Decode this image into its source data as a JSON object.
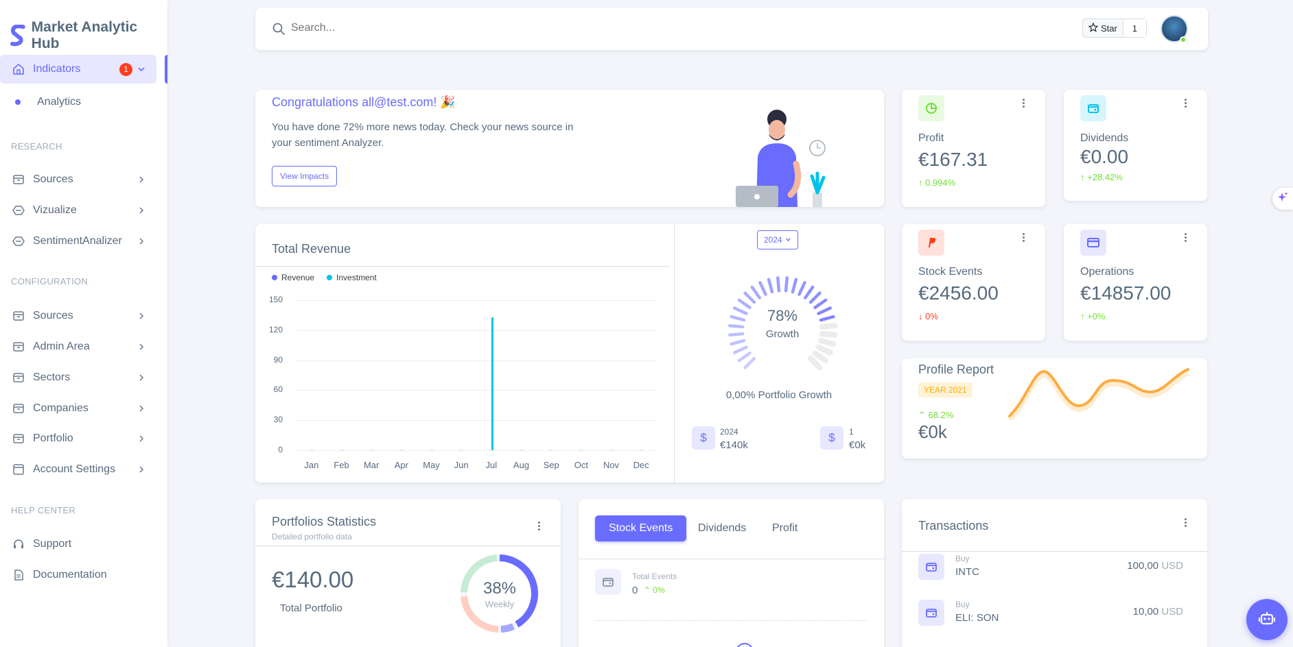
{
  "brand": {
    "name": "Market Analytic Hub"
  },
  "search": {
    "placeholder": "Search..."
  },
  "github": {
    "star_label": "Star",
    "star_count": "1"
  },
  "sidebar": {
    "active": {
      "label": "Indicators",
      "badge": "1"
    },
    "sub_item": "Analytics",
    "research_header": "RESEARCH",
    "research": [
      "Sources",
      "Vizualize",
      "SentimentAnalizer"
    ],
    "config_header": "CONFIGURATION",
    "config": [
      "Sources",
      "Admin Area",
      "Sectors",
      "Companies",
      "Portfolio",
      "Account Settings"
    ],
    "help_header": "HELP CENTER",
    "help": [
      "Support",
      "Documentation"
    ]
  },
  "welcome": {
    "title": "Congratulations all@test.com! 🎉",
    "text": "You have done 72% more news today. Check your news source in your sentiment Analyzer.",
    "button": "View Impacts"
  },
  "stats": {
    "profit": {
      "label": "Profit",
      "value": "€167.31",
      "change": "0.994%",
      "direction": "up"
    },
    "dividends": {
      "label": "Dividends",
      "value": "€0.00",
      "change": "+28.42%",
      "direction": "up"
    },
    "stock_events": {
      "label": "Stock Events",
      "value": "€2456.00",
      "change": "0%",
      "direction": "down"
    },
    "operations": {
      "label": "Operations",
      "value": "€14857.00",
      "change": "+0%",
      "direction": "up"
    }
  },
  "revenue": {
    "title": "Total Revenue",
    "year_button": "2024",
    "growth_percent": "78%",
    "growth_label": "Growth",
    "growth_value": 0.78,
    "portfolio_growth": "0,00% Portfolio Growth",
    "summary": [
      {
        "label": "2024",
        "value": "€140k"
      },
      {
        "label": "1",
        "value": "€0k"
      }
    ]
  },
  "chart_data": {
    "type": "bar",
    "categories": [
      "Jan",
      "Feb",
      "Mar",
      "Apr",
      "May",
      "Jun",
      "Jul",
      "Aug",
      "Sep",
      "Oct",
      "Nov",
      "Dec"
    ],
    "series": [
      {
        "name": "Revenue",
        "values": [
          0,
          0,
          0,
          0,
          0,
          0,
          0,
          0,
          0,
          0,
          0,
          0
        ],
        "color": "#696cff"
      },
      {
        "name": "Investment",
        "values": [
          0,
          0,
          0,
          0,
          0,
          0,
          133,
          0,
          0,
          0,
          0,
          0
        ],
        "color": "#03c3ec"
      }
    ],
    "yticks": [
      "150",
      "120",
      "90",
      "60",
      "30",
      "0"
    ],
    "ylim": [
      0,
      150
    ],
    "grid": true,
    "legend": "top-left"
  },
  "profile": {
    "title": "Profile Report",
    "badge": "YEAR 2021",
    "change": "68.2%",
    "value": "€0k"
  },
  "portfolio_stats": {
    "title": "Portfolios Statistics",
    "subtitle": "Detailed portfolio data",
    "value": "€140.00",
    "label": "Total Portfolio",
    "donut_percent": "38%",
    "donut_label": "Weekly"
  },
  "tabs": {
    "items": [
      "Stock Events",
      "Dividends",
      "Profit"
    ],
    "active": "Stock Events",
    "total_label": "Total Events",
    "total_value": "0",
    "total_change": "0%"
  },
  "transactions": {
    "title": "Transactions",
    "rows": [
      {
        "type": "Buy",
        "name": "INTC",
        "amount": "100,00",
        "currency": "USD"
      },
      {
        "type": "Buy",
        "name": "ELI: SON",
        "amount": "10,00",
        "currency": "USD"
      }
    ]
  },
  "colors": {
    "primary": "#696cff",
    "success": "#71dd37",
    "danger": "#ff3e1d",
    "info": "#03c3ec",
    "warning": "#ffab00"
  }
}
